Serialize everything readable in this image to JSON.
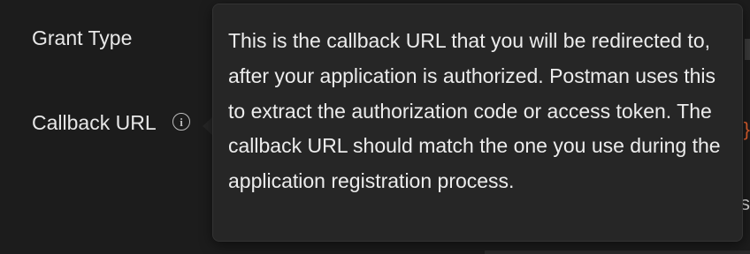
{
  "form": {
    "grant_type_label": "Grant Type",
    "callback_url_label": "Callback URL",
    "info_icon": "info-circle-icon",
    "info_glyph": "i"
  },
  "tooltip": {
    "text": "This is the callback URL that you will be redirected to, after your application is authorized. Postman uses this to extract the authorization code or access token. The callback URL should match the one you use during the application registration process."
  },
  "edge_hints": {
    "brace": "}",
    "s": "s"
  },
  "colors": {
    "background": "#1c1c1c",
    "tooltip_background": "#262626",
    "brace_accent": "#e0602f"
  }
}
